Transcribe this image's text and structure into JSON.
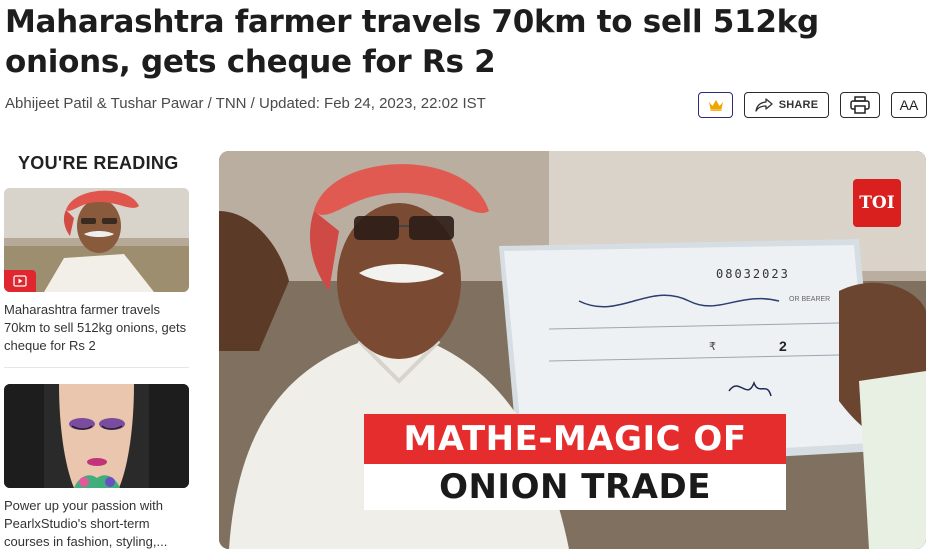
{
  "article": {
    "headline": "Maharashtra farmer travels 70km to sell 512kg onions, gets cheque for Rs 2",
    "byline": "Abhijeet Patil & Tushar Pawar / TNN / Updated: Feb 24, 2023, 22:02 IST"
  },
  "toolbar": {
    "share_label": "SHARE",
    "font_size_label": "AA",
    "icons": [
      "crown-icon",
      "share-icon",
      "print-icon"
    ]
  },
  "sidebar": {
    "title": "YOU'RE READING",
    "cards": [
      {
        "caption": "Maharashtra farmer travels 70km to sell 512kg onions, gets cheque for Rs 2",
        "badge": "video-play-icon"
      },
      {
        "caption": "Power up your passion with PearlxStudio's short-term courses in fashion, styling,..."
      }
    ]
  },
  "hero": {
    "brand_badge": "TOI",
    "overlay_line1": "MATHE-MAGIC OF",
    "overlay_line2": "ONION TRADE",
    "cheque": {
      "number": "08032023",
      "bearer": "OR BEARER",
      "amount": "2",
      "rupee_symbol": "₹"
    }
  },
  "colors": {
    "accent_red": "#e52d2d",
    "toi_red": "#d9201f",
    "crown_gold": "#f0a500",
    "crown_border": "#2b2b7a"
  }
}
